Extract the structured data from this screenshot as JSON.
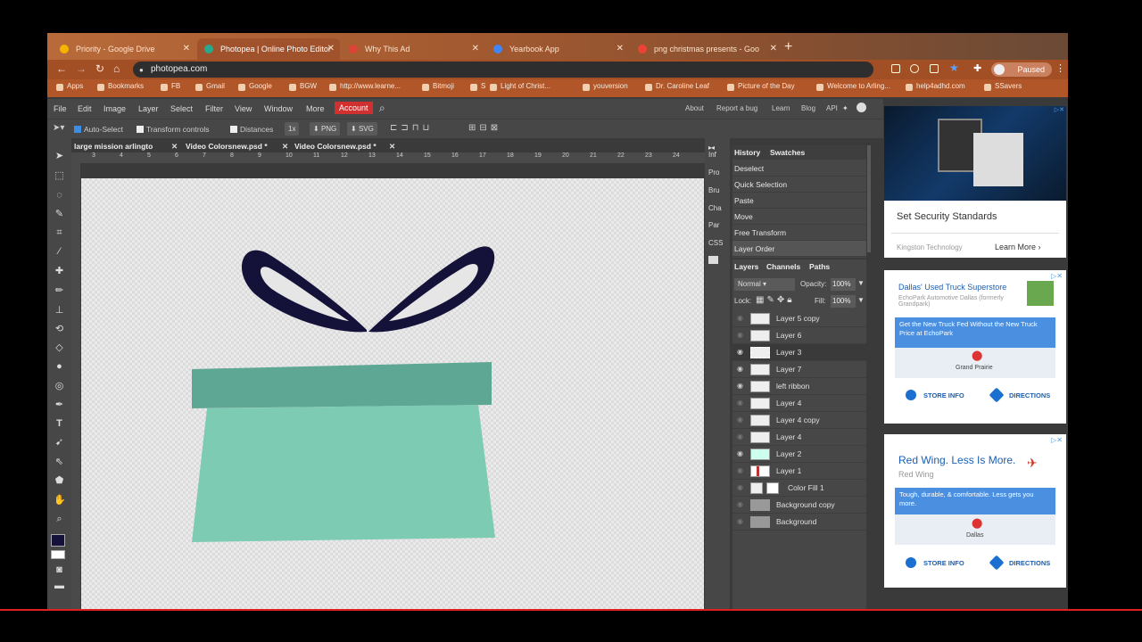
{
  "browser": {
    "tabs": [
      {
        "label": "Priority - Google Drive",
        "active": false,
        "color": "#f4b400"
      },
      {
        "label": "Photopea | Online Photo Editor",
        "active": true,
        "color": "#29a98b"
      },
      {
        "label": "Why This Ad",
        "active": false,
        "color": "#db4437"
      },
      {
        "label": "Yearbook App",
        "active": false,
        "color": "#4285f4"
      },
      {
        "label": "png christmas presents - Goo",
        "active": false,
        "color": "#ea4335"
      }
    ],
    "url": "photopea.com",
    "profile_status": "Paused",
    "bookmarks": [
      "Apps",
      "Bookmarks",
      "FB",
      "Gmail",
      "Google",
      "BGW",
      "http://www.learne...",
      "Bitmoji",
      "S",
      "Light of Christ...",
      "youversion",
      "Dr. Caroline Leaf",
      "Picture of the Day",
      "Welcome to Arling...",
      "help4adhd.com",
      "SSavers"
    ]
  },
  "menu": {
    "items": [
      "File",
      "Edit",
      "Image",
      "Layer",
      "Select",
      "Filter",
      "View",
      "Window",
      "More"
    ],
    "account": "Account",
    "right_items": [
      "About",
      "Report a bug",
      "Learn",
      "Blog",
      "API"
    ]
  },
  "options": {
    "auto_select": "Auto-Select",
    "transform_controls": "Transform controls",
    "distances": "Distances",
    "zoom": "1x",
    "png": "PNG",
    "svg": "SVG"
  },
  "documents": [
    {
      "name": "large mission arlingto"
    },
    {
      "name": "Video Colorsnew.psd *"
    },
    {
      "name": "Video Colorsnew.psd *"
    }
  ],
  "ruler_numbers": [
    "3",
    "4",
    "5",
    "6",
    "7",
    "8",
    "9",
    "10",
    "11",
    "12",
    "13",
    "14",
    "15",
    "16",
    "17",
    "18",
    "19",
    "20",
    "21",
    "22",
    "23",
    "24"
  ],
  "side_labels": [
    "Inf",
    "Pro",
    "Bru",
    "Cha",
    "Par",
    "CSS"
  ],
  "history": {
    "tabs": [
      "History",
      "Swatches"
    ],
    "items": [
      "Deselect",
      "Quick Selection",
      "Paste",
      "Move",
      "Free Transform",
      "Layer Order"
    ]
  },
  "layers": {
    "tabs": [
      "Layers",
      "Channels",
      "Paths"
    ],
    "blend_mode": "Normal",
    "opacity_label": "Opacity:",
    "opacity": "100%",
    "lock_label": "Lock:",
    "fill_label": "Fill:",
    "fill": "100%",
    "items": [
      {
        "name": "Layer 5 copy",
        "visible": false
      },
      {
        "name": "Layer 6",
        "visible": false
      },
      {
        "name": "Layer 3",
        "visible": true
      },
      {
        "name": "Layer 7",
        "visible": true
      },
      {
        "name": "left ribbon",
        "visible": true
      },
      {
        "name": "Layer 4",
        "visible": false
      },
      {
        "name": "Layer 4 copy",
        "visible": false
      },
      {
        "name": "Layer 4",
        "visible": false
      },
      {
        "name": "Layer 2",
        "visible": true
      },
      {
        "name": "Layer 1",
        "visible": false
      },
      {
        "name": "Color Fill 1",
        "visible": false
      },
      {
        "name": "Background copy",
        "visible": false
      },
      {
        "name": "Background",
        "visible": false
      }
    ]
  },
  "ads": {
    "ad1": {
      "headline": "Set Security Standards",
      "advertiser": "Kingston Technology",
      "cta": "Learn More"
    },
    "ad2": {
      "title": "Dallas' Used Truck Superstore",
      "subtitle": "EchoPark Automotive Dallas (formerly Grandpark)",
      "banner": "Get the New Truck Fed Without the New Truck Price at EchoPark",
      "place": "Grand Prairie",
      "store": "STORE INFO",
      "directions": "DIRECTIONS"
    },
    "ad3": {
      "title": "Red Wing. Less Is More.",
      "brand": "Red Wing",
      "banner": "Tough, durable, & comfortable. Less gets you more.",
      "place": "Dallas",
      "store": "STORE INFO",
      "directions": "DIRECTIONS"
    }
  },
  "colors": {
    "gift_box": "#7ccbb2",
    "gift_lid": "#5fa795",
    "ribbon": "#15123a",
    "accent": "#d03030"
  }
}
